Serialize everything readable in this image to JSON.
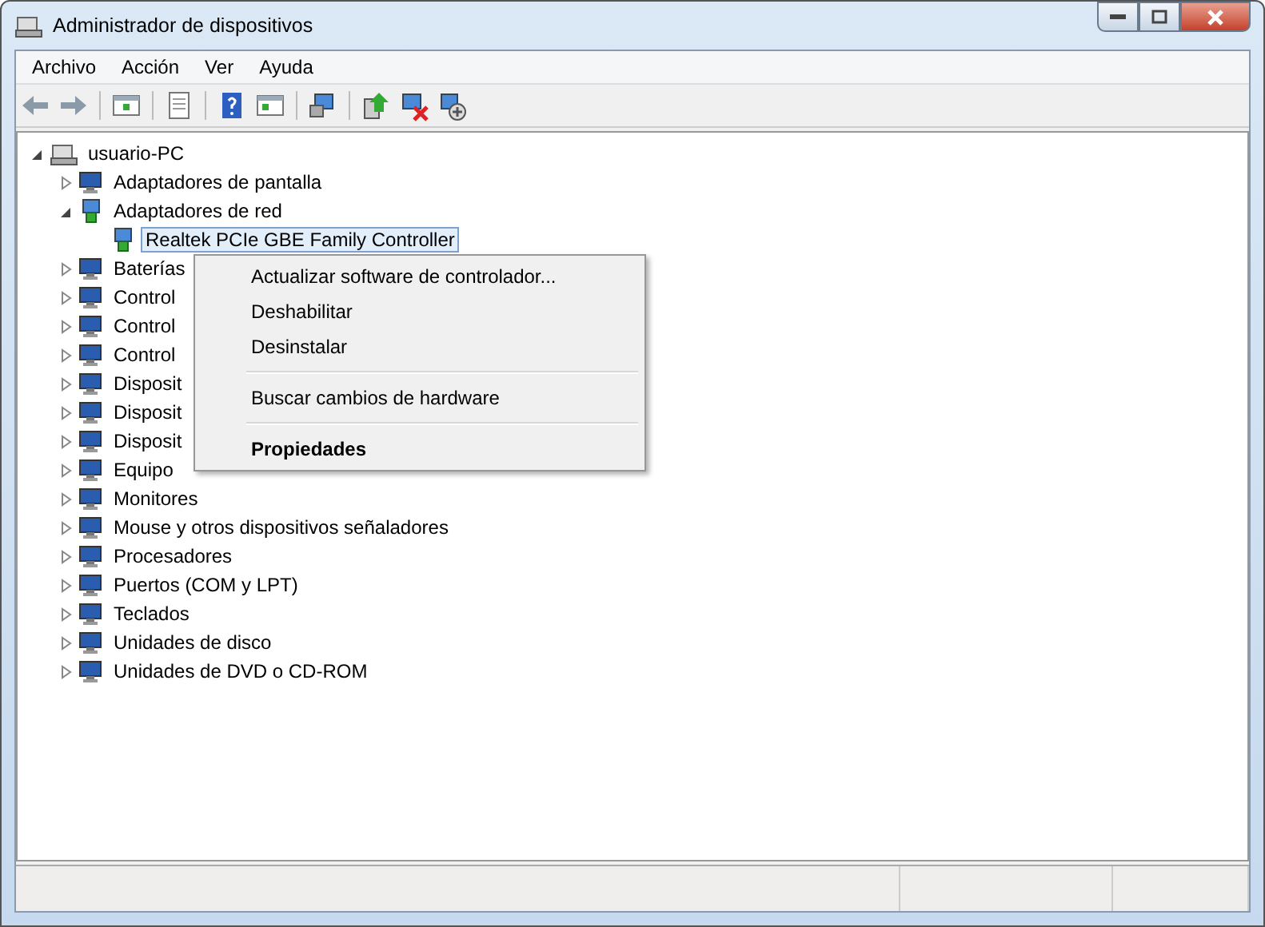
{
  "window": {
    "title": "Administrador de dispositivos"
  },
  "menu_bar": [
    "Archivo",
    "Acción",
    "Ver",
    "Ayuda"
  ],
  "tree": {
    "label": "usuario-PC",
    "expanded": true,
    "selected": false,
    "children": [
      {
        "label": "Adaptadores de pantalla",
        "expanded": false,
        "selected": false
      },
      {
        "label": "Adaptadores de red",
        "expanded": true,
        "selected": false,
        "children": [
          {
            "label": "Realtek PCIe GBE Family Controller",
            "selected": true
          }
        ]
      },
      {
        "label": "Baterías",
        "expanded": false,
        "selected": false
      },
      {
        "label": "Control",
        "expanded": false,
        "selected": false
      },
      {
        "label": "Control",
        "expanded": false,
        "selected": false
      },
      {
        "label": "Control",
        "expanded": false,
        "selected": false
      },
      {
        "label": "Disposit",
        "expanded": false,
        "selected": false
      },
      {
        "label": "Disposit",
        "expanded": false,
        "selected": false
      },
      {
        "label": "Disposit",
        "expanded": false,
        "selected": false
      },
      {
        "label": "Equipo",
        "expanded": false,
        "selected": false
      },
      {
        "label": "Monitores",
        "expanded": false,
        "selected": false
      },
      {
        "label": "Mouse y otros dispositivos señaladores",
        "expanded": false,
        "selected": false
      },
      {
        "label": "Procesadores",
        "expanded": false,
        "selected": false
      },
      {
        "label": "Puertos (COM y LPT)",
        "expanded": false,
        "selected": false
      },
      {
        "label": "Teclados",
        "expanded": false,
        "selected": false
      },
      {
        "label": "Unidades de disco",
        "expanded": false,
        "selected": false
      },
      {
        "label": "Unidades de DVD o CD-ROM",
        "expanded": false,
        "selected": false
      }
    ]
  },
  "context_menu": [
    {
      "label": "Actualizar software de controlador...",
      "separator_before": false,
      "bold": false
    },
    {
      "label": "Deshabilitar",
      "separator_before": false,
      "bold": false
    },
    {
      "label": "Desinstalar",
      "separator_before": false,
      "bold": false
    },
    {
      "label": "Buscar cambios de hardware",
      "separator_before": true,
      "bold": false
    },
    {
      "label": "Propiedades",
      "separator_before": true,
      "bold": true
    }
  ]
}
